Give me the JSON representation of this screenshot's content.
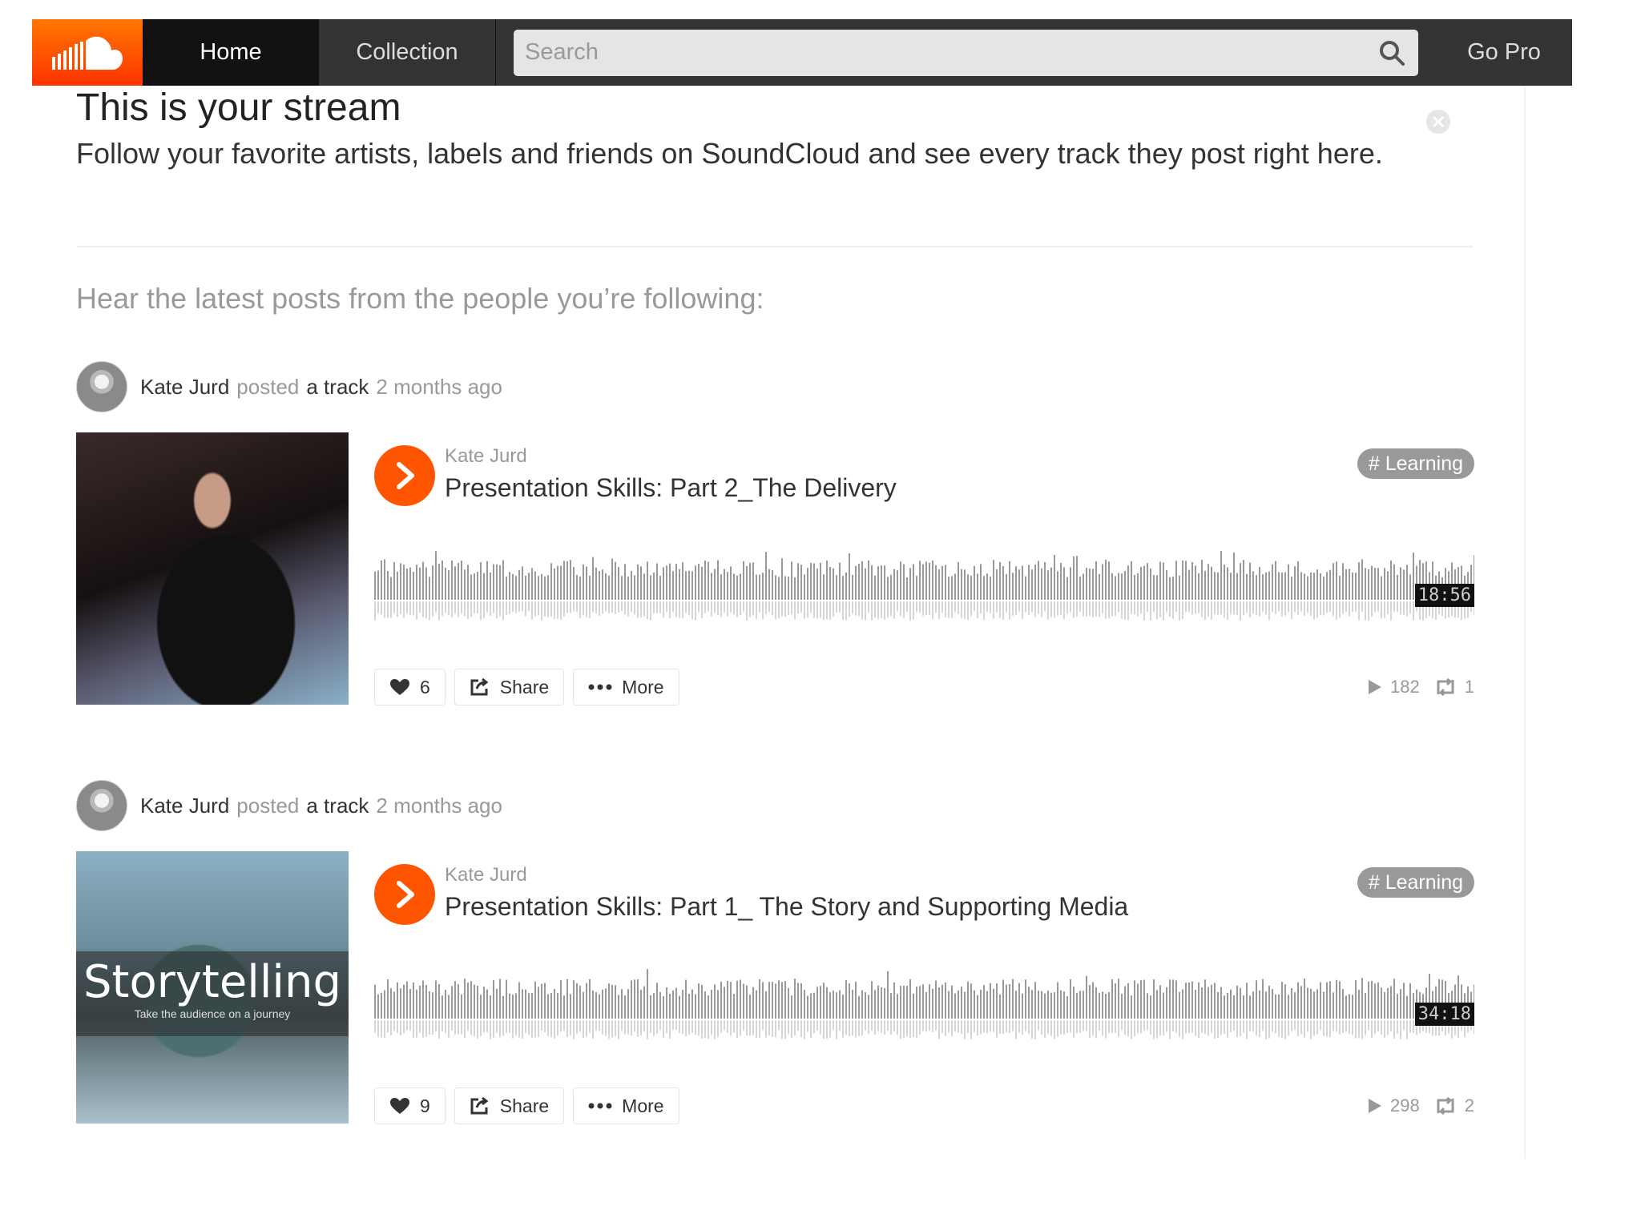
{
  "nav": {
    "home": "Home",
    "collection": "Collection",
    "search_placeholder": "Search",
    "gopro": "Go Pro"
  },
  "stream": {
    "title": "This is your stream",
    "intro": "Follow your favorite artists, labels and friends on SoundCloud and see every track they post right here.",
    "subhead": "Hear the latest posts from the people you’re following:"
  },
  "posts": [
    {
      "poster": "Kate Jurd",
      "verb": "posted",
      "object": "a track",
      "time": "2 months ago",
      "artist": "Kate Jurd",
      "title": "Presentation Skills: Part 2_The Delivery",
      "tag": "# Learning",
      "duration": "18:56",
      "likes": "6",
      "share": "Share",
      "more": "More",
      "plays": "182",
      "reposts": "1"
    },
    {
      "poster": "Kate Jurd",
      "verb": "posted",
      "object": "a track",
      "time": "2 months ago",
      "artist": "Kate Jurd",
      "title": "Presentation Skills: Part 1_ The Story and Supporting Media",
      "tag": "# Learning",
      "duration": "34:18",
      "likes": "9",
      "share": "Share",
      "more": "More",
      "plays": "298",
      "reposts": "2",
      "artwork_title": "Storytelling",
      "artwork_subtitle": "Take the audience on a journey"
    }
  ],
  "colors": {
    "accent": "#ff5500",
    "topbar": "#333333",
    "waveform": "#999999"
  }
}
